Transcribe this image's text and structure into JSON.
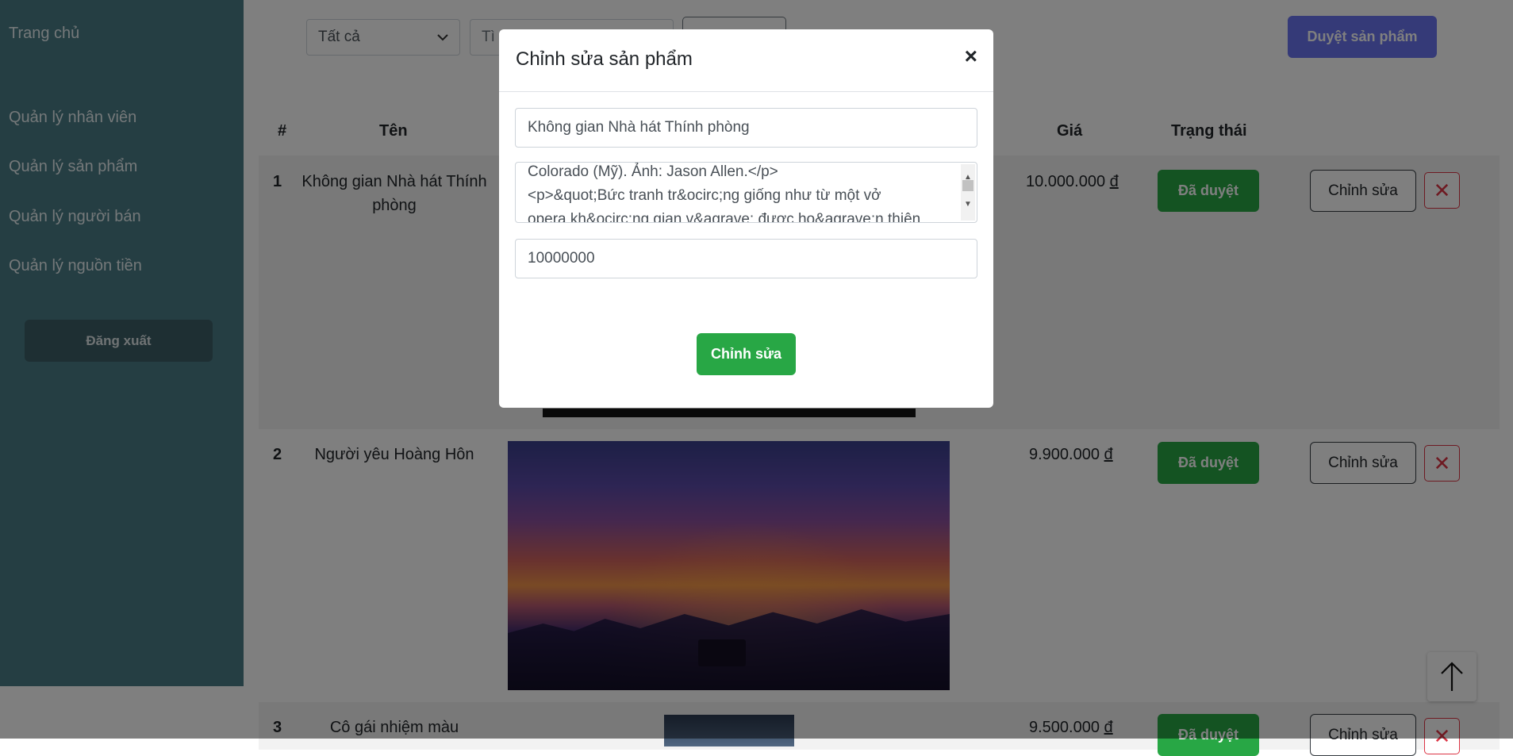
{
  "sidebar": {
    "items": [
      {
        "label": "Trang chủ"
      },
      {
        "label": "Quản lý nhân viên"
      },
      {
        "label": "Quản lý sản phẩm"
      },
      {
        "label": "Quản lý người bán"
      },
      {
        "label": "Quản lý nguồn tiền"
      }
    ],
    "logout_label": "Đăng xuất"
  },
  "filters": {
    "category_selected": "Tất cả",
    "search_value": "Tì"
  },
  "toolbar": {
    "approve_label": "Duyệt sản phẩm"
  },
  "table": {
    "headers": [
      "#",
      "Tên",
      "Giá",
      "Trạng thái"
    ],
    "rows": [
      {
        "num": "1",
        "name": "Không gian Nhà hát Thính phòng",
        "price": "10.000.000",
        "currency": "đ",
        "status": "Đã duyệt",
        "edit": "Chỉnh sửa",
        "delete": "✕"
      },
      {
        "num": "2",
        "name": "Người yêu Hoàng Hôn",
        "price": "9.900.000",
        "currency": "đ",
        "status": "Đã duyệt",
        "edit": "Chỉnh sửa",
        "delete": "✕"
      },
      {
        "num": "3",
        "name": "Cô gái nhiệm màu",
        "price": "9.500.000",
        "currency": "đ",
        "status": "Đã duyệt",
        "edit": "Chỉnh sửa",
        "delete": "✕"
      }
    ]
  },
  "modal": {
    "title": "Chỉnh sửa sản phẩm",
    "close": "×",
    "name_value": "Không gian Nhà hát Thính phòng",
    "description_lines": [
      "Colorado (Mỹ). Ảnh: Jason Allen.</p>",
      "<p>&quot;Bức tranh tr&ocirc;ng giống như từ một vở",
      "opera kh&ocirc;ng gian v&agrave; được ho&agrave;n thiện"
    ],
    "price_value": "10000000",
    "submit_label": "Chỉnh sửa"
  },
  "icons": {
    "scroll_top": "arrow-up-icon",
    "close": "close-icon",
    "delete": "x-icon",
    "dropdown": "chevron-down-icon"
  },
  "colors": {
    "sidebar": "#4a7c87",
    "primary": "#6a75f0",
    "success": "#28a745",
    "danger": "#dc3545"
  }
}
